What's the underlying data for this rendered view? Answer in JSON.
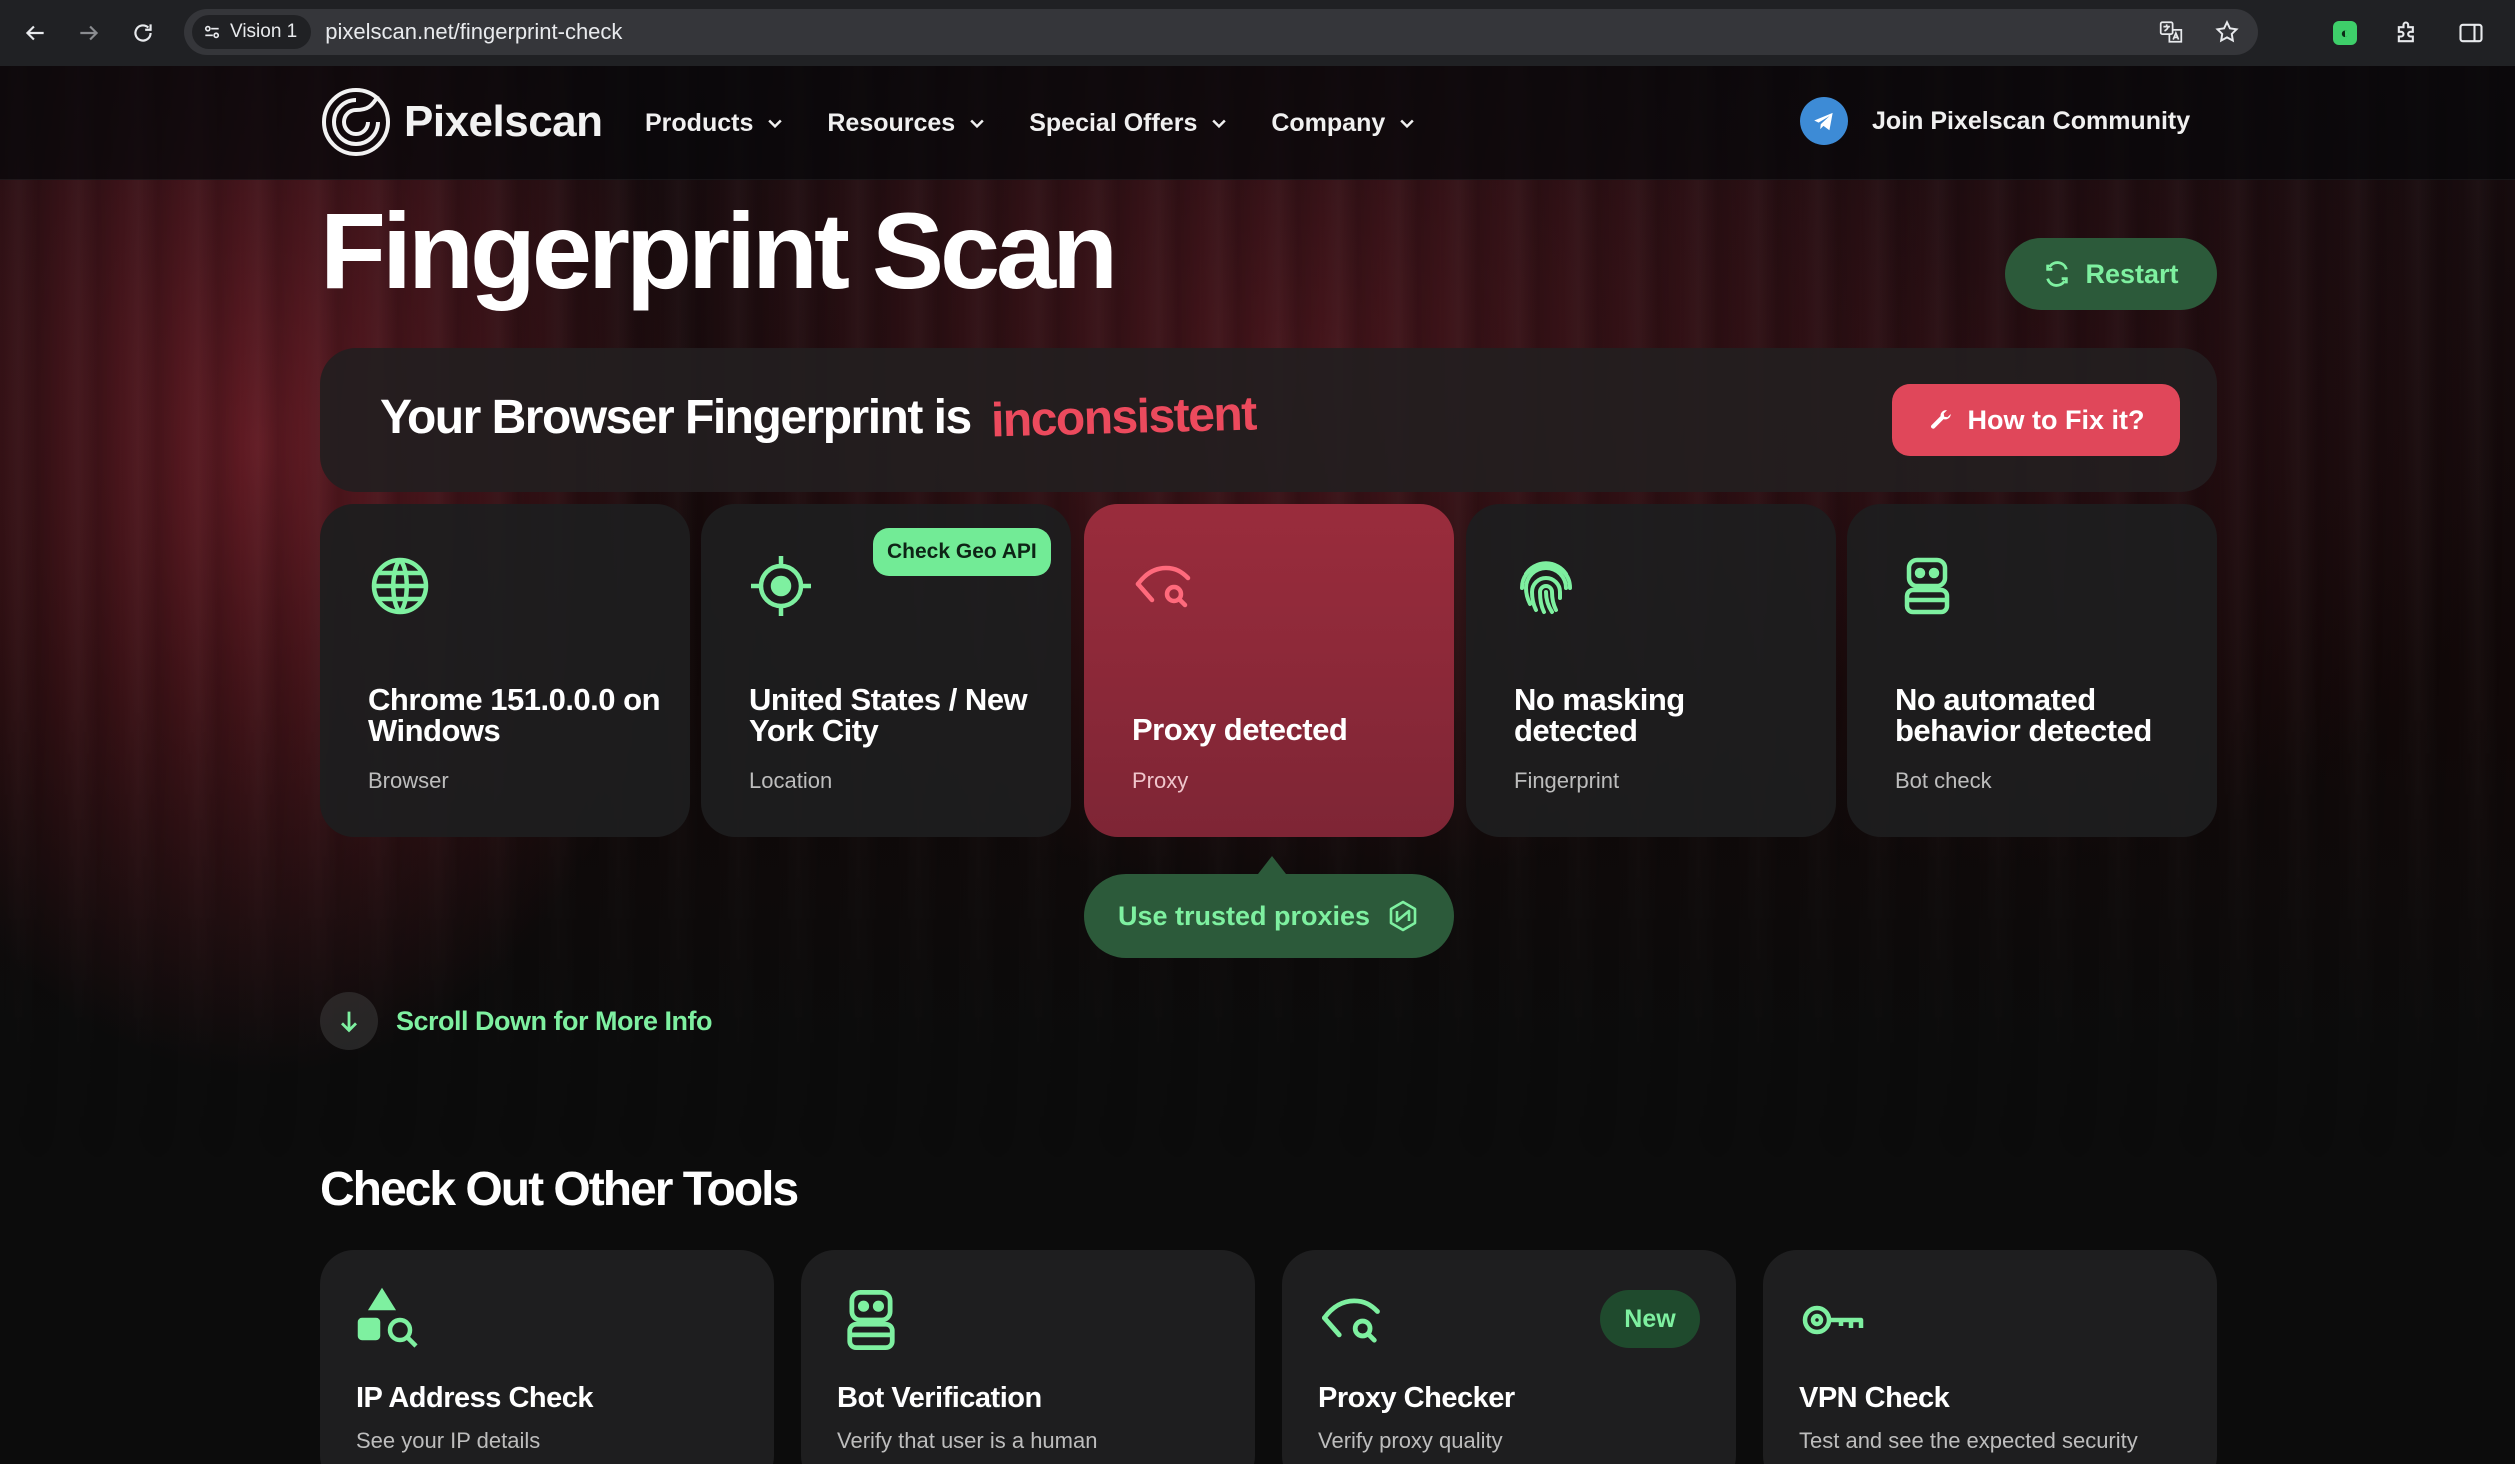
{
  "browser": {
    "profile_chip": "Vision 1",
    "url": "pixelscan.net/fingerprint-check"
  },
  "header": {
    "logo_text": "Pixelscan",
    "nav": [
      "Products",
      "Resources",
      "Special Offers",
      "Company"
    ],
    "community": "Join Pixelscan Community"
  },
  "hero": {
    "title": "Fingerprint Scan",
    "restart": "Restart",
    "status_prefix": "Your Browser Fingerprint is",
    "status_word": "inconsistent",
    "fix_button": "How to Fix it?"
  },
  "cards": [
    {
      "icon": "globe-icon",
      "title": "Chrome 151.0.0.0 on Windows",
      "sub": "Browser"
    },
    {
      "icon": "crosshair-icon",
      "title": "United States / New York City",
      "sub": "Location",
      "badge": "Check Geo API"
    },
    {
      "icon": "proxy-eye-icon",
      "title": "Proxy detected",
      "sub": "Proxy"
    },
    {
      "icon": "fingerprint-icon",
      "title": "No masking detected",
      "sub": "Fingerprint"
    },
    {
      "icon": "robot-icon",
      "title": "No automated behavior detected",
      "sub": "Bot check"
    }
  ],
  "trusted_proxies": "Use trusted proxies",
  "scroll_more": "Scroll Down for More Info",
  "tools": {
    "title": "Check Out Other Tools",
    "items": [
      {
        "icon": "shapes-search-icon",
        "title": "IP Address Check",
        "sub": "See your IP details"
      },
      {
        "icon": "robot-icon",
        "title": "Bot Verification",
        "sub": "Verify that user is a human"
      },
      {
        "icon": "proxy-eye-icon",
        "title": "Proxy Checker",
        "sub": "Verify proxy quality",
        "badge": "New"
      },
      {
        "icon": "key-icon",
        "title": "VPN Check",
        "sub": "Test and see the expected security"
      }
    ]
  },
  "colors": {
    "accent_green": "#7ef0a0",
    "alert_red": "#e0475a",
    "card_bg": "#1e1e1f"
  }
}
